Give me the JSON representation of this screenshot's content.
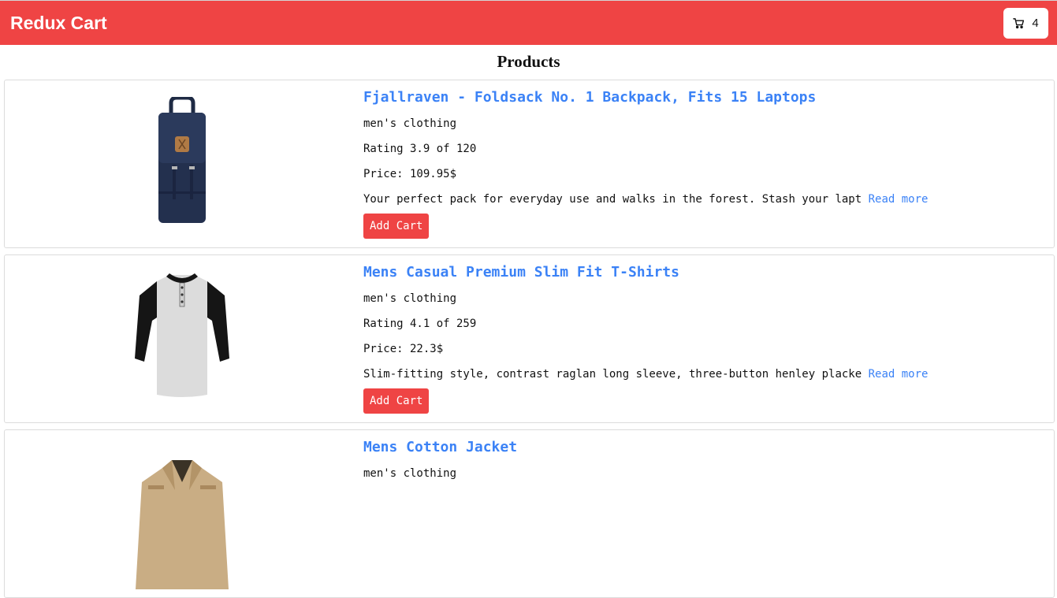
{
  "navbar": {
    "brand": "Redux Cart",
    "cart": {
      "icon": "cart-icon",
      "count": "4"
    },
    "color": "#ef4444"
  },
  "page": {
    "title": "Products"
  },
  "products": [
    {
      "title": "Fjallraven - Foldsack No. 1 Backpack, Fits 15 Laptops",
      "category": "men's clothing",
      "rating": "Rating 3.9 of 120",
      "price": "Price: 109.95$",
      "description": "Your perfect pack for everyday use and walks in the forest. Stash your lapt",
      "read_more": "Read more",
      "add_label": "Add Cart",
      "image": "backpack-image"
    },
    {
      "title": "Mens Casual Premium Slim Fit T-Shirts",
      "category": "men's clothing",
      "rating": "Rating 4.1 of 259",
      "price": "Price: 22.3$",
      "description": "Slim-fitting style, contrast raglan long sleeve, three-button henley placke",
      "read_more": "Read more",
      "add_label": "Add Cart",
      "image": "tshirt-image"
    },
    {
      "title": "Mens Cotton Jacket",
      "category": "men's clothing",
      "image": "jacket-image"
    }
  ],
  "colors": {
    "accent": "#ef4444",
    "link": "#3b82f6"
  }
}
